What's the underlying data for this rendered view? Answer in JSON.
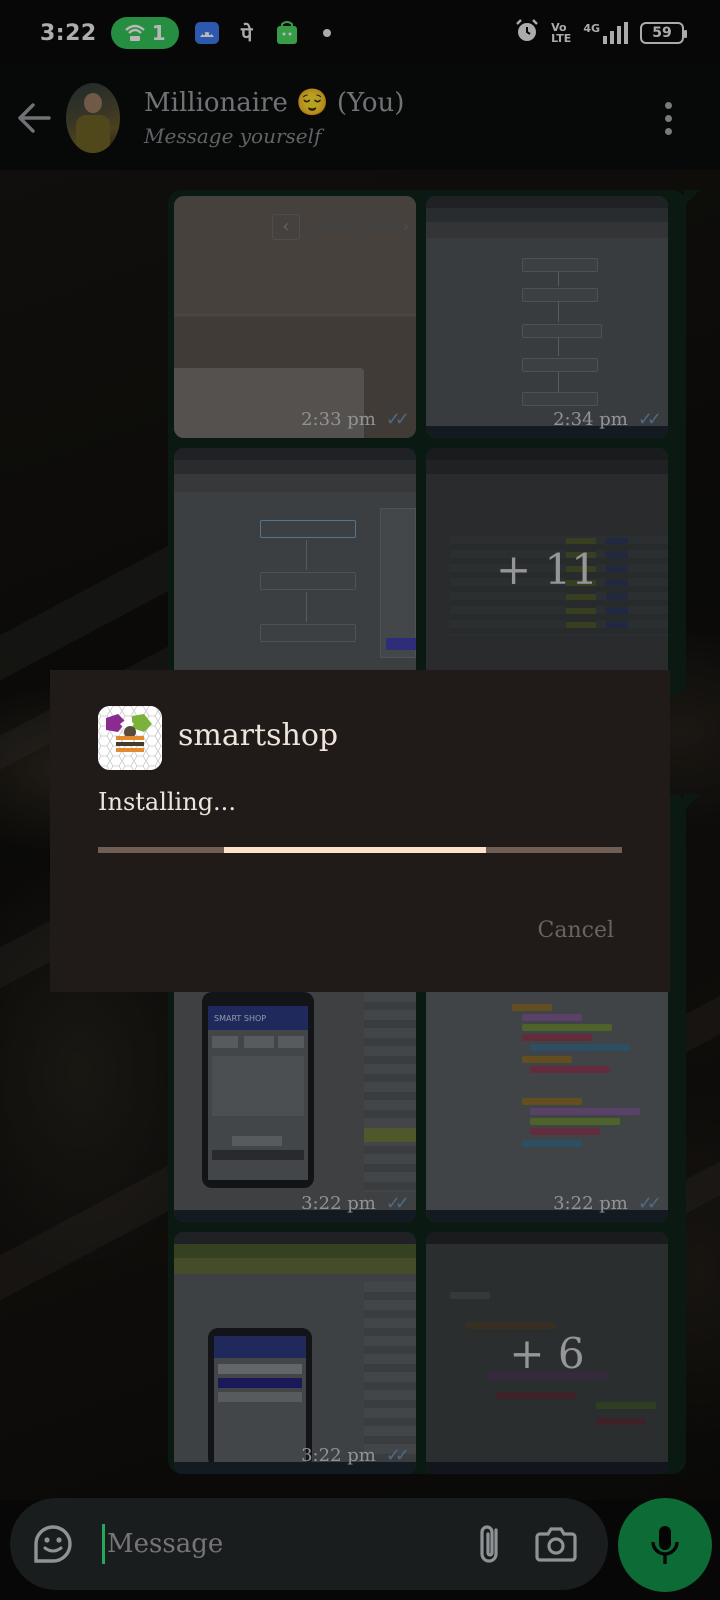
{
  "status_bar": {
    "time": "3:22",
    "hotspot_count": "1",
    "battery": "59",
    "network_label": "4G",
    "volte_label": "Vo\nLTE",
    "icons": [
      "hotspot-icon",
      "android-icon",
      "phonepe-icon",
      "shopping-icon",
      "dot-icon",
      "alarm-icon",
      "volte-icon",
      "signal-icon",
      "battery-icon"
    ]
  },
  "header": {
    "contact_name": "Millionaire 😌 (You)",
    "subtitle": "Message yourself",
    "icons": [
      "back-arrow-icon",
      "avatar",
      "more-vert-icon"
    ]
  },
  "chat": {
    "bubble_top": {
      "thumbs": [
        {
          "time": "2:33 pm",
          "status": "read"
        },
        {
          "time": "2:34 pm",
          "status": "read"
        },
        {
          "time": "",
          "status": ""
        },
        {
          "time": "",
          "status": "",
          "more_count": "+ 11"
        }
      ],
      "first_thumb_nav": "Next step"
    },
    "bubble_bottom": {
      "thumbs": [
        {
          "time": "3:22 pm",
          "status": "read"
        },
        {
          "time": "3:22 pm",
          "status": "read"
        },
        {
          "time": "3:22 pm",
          "status": "read"
        },
        {
          "time": "",
          "status": "",
          "more_count": "+ 6"
        }
      ],
      "phone_title": "SMART SHOP"
    }
  },
  "dialog": {
    "app_name": "smartshop",
    "status": "Installing...",
    "progress_start": 0.24,
    "progress_end": 0.74,
    "cancel_label": "Cancel"
  },
  "input_bar": {
    "placeholder": "Message",
    "icons": [
      "sticker-icon",
      "attach-icon",
      "camera-icon",
      "mic-icon"
    ]
  },
  "colors": {
    "bubble": "#0e2519",
    "dialog_bg": "#201b18",
    "progress_fill": "#fde1cb",
    "mic_button": "#0d6b36",
    "hotspot_pill": "#35c55a",
    "tick_read": "#6b93b9"
  }
}
